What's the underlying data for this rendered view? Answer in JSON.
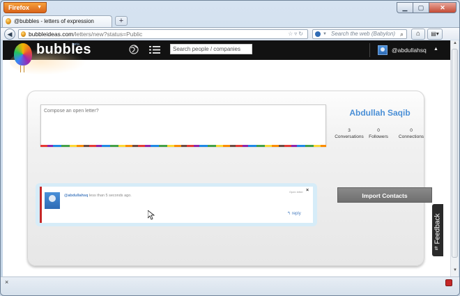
{
  "browser": {
    "menu_button": "Firefox",
    "tab_title": "@bubbles - letters of expression",
    "new_tab": "+",
    "url_domain": "bubbleideas.com",
    "url_path": "/letters/new?status=Public",
    "search_placeholder": "Search the web (Babylon)",
    "status_close": "×"
  },
  "app": {
    "logo_text": "bubbles",
    "logo_beta": "beta",
    "people_search_placeholder": "Search people / companies",
    "username": "@abdullahsq"
  },
  "compose": {
    "placeholder": "Compose an open letter?"
  },
  "profile": {
    "name": "Abdullah Saqib",
    "stats": [
      {
        "value": "3",
        "label": "Conversations"
      },
      {
        "value": "0",
        "label": "Followers"
      },
      {
        "value": "0",
        "label": "Connections"
      }
    ]
  },
  "feed": {
    "user": "@abdullahsq",
    "time": "less than 5 seconds ago.",
    "open_letter": "Open letter",
    "close": "×",
    "reply": "reply"
  },
  "actions": {
    "import_contacts": "Import Contacts",
    "feedback": "Feedback"
  }
}
